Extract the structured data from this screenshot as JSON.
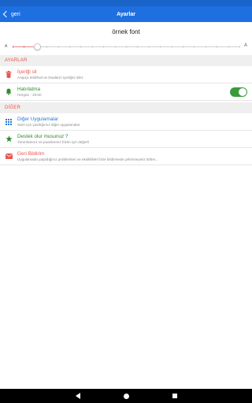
{
  "header": {
    "back_label": "geri",
    "title": "Ayarlar"
  },
  "font": {
    "sample_text": "örnek font",
    "small_marker": "A",
    "large_marker": "A",
    "size_level": 0.11
  },
  "sections": {
    "settings": {
      "label": "AYARLAR"
    },
    "other": {
      "label": "DİĞER"
    }
  },
  "items": {
    "clear": {
      "title": "İçeriği sil",
      "subtitle": "Arapça tesbihat ve Duaların içeriğini siler."
    },
    "reminder": {
      "title": "Hatırlatma",
      "subtitle": "Hergün - 20:00",
      "enabled": true
    },
    "apps": {
      "title": "Diğer Uygulamalar",
      "subtitle": "Sizin için yazdığımız diğer uygulamalar"
    },
    "support": {
      "title": "Destek olur musunuz ?",
      "subtitle": "Yorumlarınız ve puanlarınız bizim için değerli"
    },
    "feedback": {
      "title": "Geri Bildirim",
      "subtitle": "Uygulamada yaşadığınız problemleri ve eksiklikleri bize bildirmede çekinmeyiniz lütfen..."
    }
  },
  "colors": {
    "app_bar": "#1e6fe0",
    "section_text": "#e8554e",
    "red": "#e8554e",
    "green": "#2e8b2e",
    "blue": "#2a7ad8",
    "toggle_on": "#3b9b3b"
  },
  "icons": {
    "back": "chevron-left-icon",
    "clear": "trash-icon",
    "reminder": "bell-icon",
    "apps": "grid-icon",
    "support": "star-icon",
    "feedback": "envelope-icon"
  }
}
